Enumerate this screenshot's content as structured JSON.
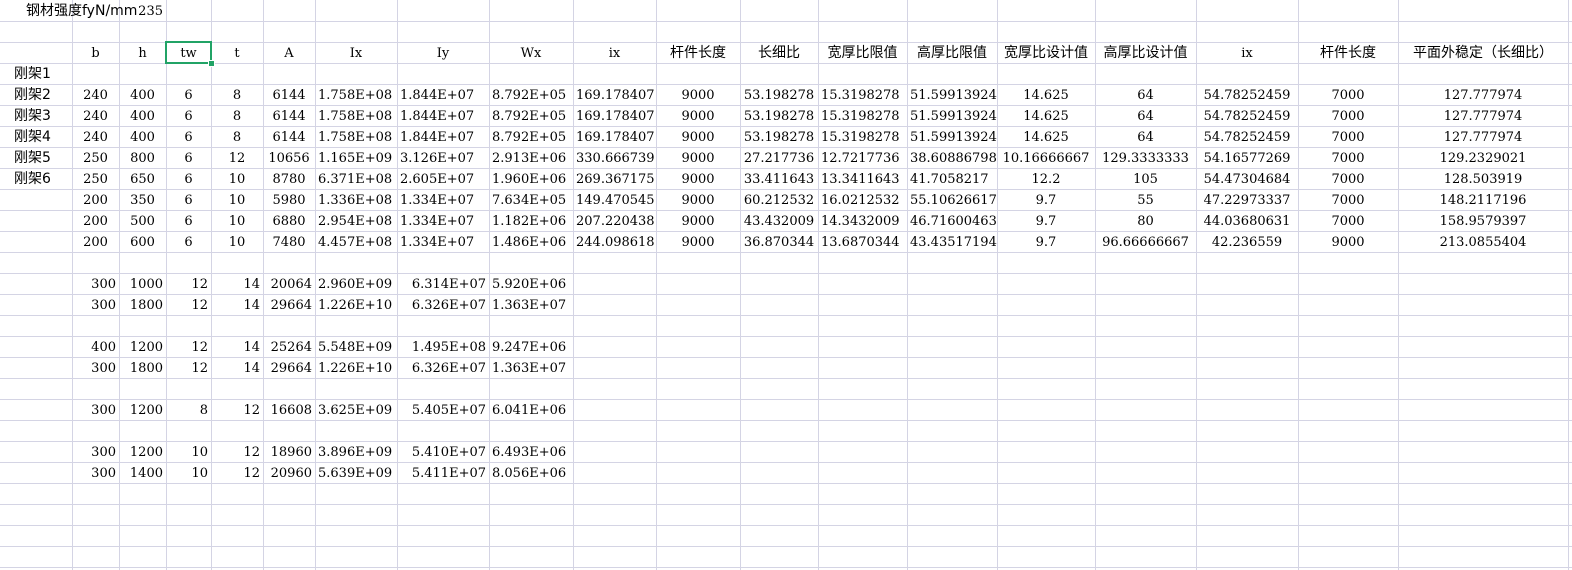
{
  "sheet": {
    "top_label": "钢材强度fyN/mm",
    "top_value": "235",
    "headers": [
      "b",
      "h",
      "tw",
      "t",
      "A",
      "Ix",
      "Iy",
      "Wx",
      "ix",
      "杆件长度",
      "长细比",
      "宽厚比限值",
      "高厚比限值",
      "宽厚比设计值",
      "高厚比设计值",
      "ix",
      "杆件长度",
      "平面外稳定（长细比）"
    ],
    "row_labels": [
      "刚架1",
      "刚架2",
      "刚架3",
      "刚架4",
      "刚架5",
      "刚架6"
    ],
    "table_rows": [
      [
        "240",
        "400",
        "6",
        "8",
        "6144",
        "1.758E+08",
        "1.844E+07",
        "8.792E+05",
        "169.178407",
        "9000",
        "53.198278",
        "15.3198278",
        "51.59913924",
        "14.625",
        "64",
        "54.78252459",
        "7000",
        "127.777974"
      ],
      [
        "240",
        "400",
        "6",
        "8",
        "6144",
        "1.758E+08",
        "1.844E+07",
        "8.792E+05",
        "169.178407",
        "9000",
        "53.198278",
        "15.3198278",
        "51.59913924",
        "14.625",
        "64",
        "54.78252459",
        "7000",
        "127.777974"
      ],
      [
        "240",
        "400",
        "6",
        "8",
        "6144",
        "1.758E+08",
        "1.844E+07",
        "8.792E+05",
        "169.178407",
        "9000",
        "53.198278",
        "15.3198278",
        "51.59913924",
        "14.625",
        "64",
        "54.78252459",
        "7000",
        "127.777974"
      ],
      [
        "250",
        "800",
        "6",
        "12",
        "10656",
        "1.165E+09",
        "3.126E+07",
        "2.913E+06",
        "330.666739",
        "9000",
        "27.217736",
        "12.7217736",
        "38.60886798",
        "10.16666667",
        "129.3333333",
        "54.16577269",
        "7000",
        "129.2329021"
      ],
      [
        "250",
        "650",
        "6",
        "10",
        "8780",
        "6.371E+08",
        "2.605E+07",
        "1.960E+06",
        "269.367175",
        "9000",
        "33.411643",
        "13.3411643",
        "41.7058217",
        "12.2",
        "105",
        "54.47304684",
        "7000",
        "128.503919"
      ],
      [
        "200",
        "350",
        "6",
        "10",
        "5980",
        "1.336E+08",
        "1.334E+07",
        "7.634E+05",
        "149.470545",
        "9000",
        "60.212532",
        "16.0212532",
        "55.10626617",
        "9.7",
        "55",
        "47.22973337",
        "7000",
        "148.2117196"
      ],
      [
        "200",
        "500",
        "6",
        "10",
        "6880",
        "2.954E+08",
        "1.334E+07",
        "1.182E+06",
        "207.220438",
        "9000",
        "43.432009",
        "14.3432009",
        "46.71600463",
        "9.7",
        "80",
        "44.03680631",
        "7000",
        "158.9579397"
      ],
      [
        "200",
        "600",
        "6",
        "10",
        "7480",
        "4.457E+08",
        "1.334E+07",
        "1.486E+06",
        "244.098618",
        "9000",
        "36.870344",
        "13.6870344",
        "43.43517194",
        "9.7",
        "96.66666667",
        "42.236559",
        "9000",
        "213.0855404"
      ]
    ],
    "extra_rows": [
      [
        "300",
        "1000",
        "12",
        "14",
        "20064",
        "2.960E+09",
        "6.314E+07",
        "5.920E+06"
      ],
      [
        "300",
        "1800",
        "12",
        "14",
        "29664",
        "1.226E+10",
        "6.326E+07",
        "1.363E+07"
      ],
      [
        "400",
        "1200",
        "12",
        "14",
        "25264",
        "5.548E+09",
        "1.495E+08",
        "9.247E+06"
      ],
      [
        "300",
        "1800",
        "12",
        "14",
        "29664",
        "1.226E+10",
        "6.326E+07",
        "1.363E+07"
      ],
      [
        "300",
        "1200",
        "8",
        "12",
        "16608",
        "3.625E+09",
        "5.405E+07",
        "6.041E+06"
      ],
      [
        "300",
        "1200",
        "10",
        "12",
        "18960",
        "3.896E+09",
        "5.410E+07",
        "6.493E+06"
      ],
      [
        "300",
        "1400",
        "10",
        "12",
        "20960",
        "5.639E+09",
        "5.411E+07",
        "8.056E+06"
      ]
    ],
    "selected_cell": "tw",
    "colors": {
      "grid": "#d4d4e4",
      "selection": "#21a366"
    }
  }
}
